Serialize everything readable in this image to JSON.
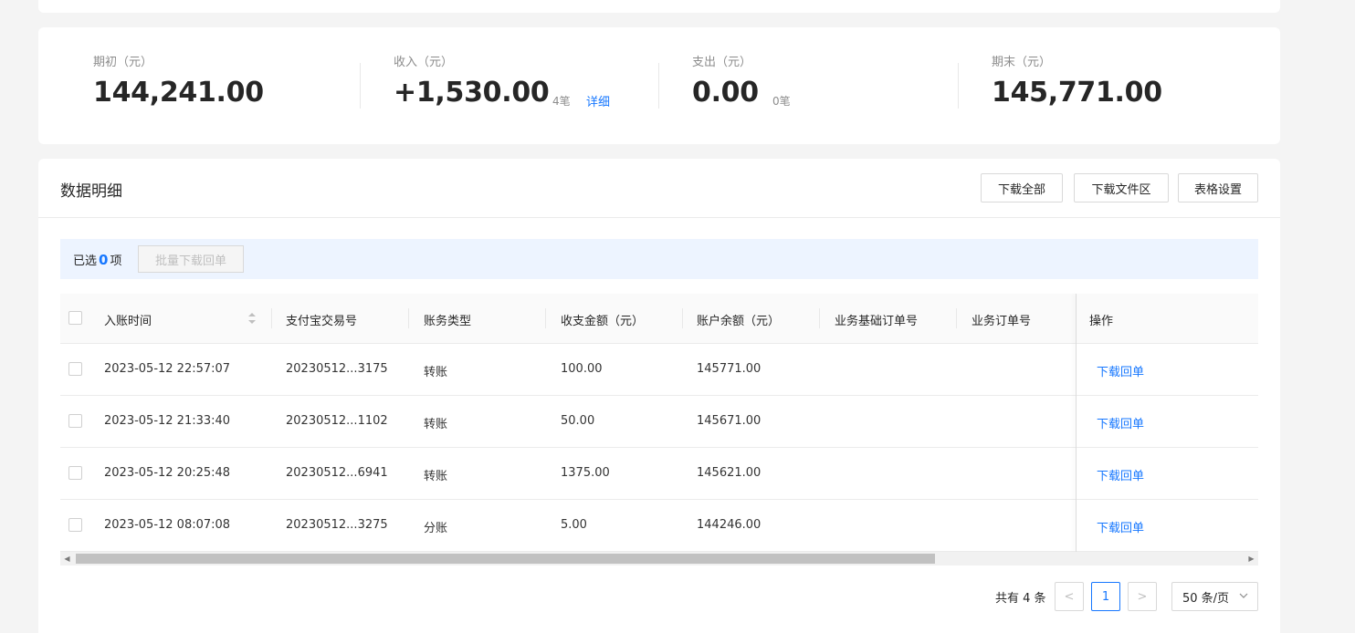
{
  "summary": [
    {
      "label": "期初（元）",
      "value": "144,241.00"
    },
    {
      "label": "收入（元）",
      "value": "+1,530.00",
      "count": "4笔",
      "link": "详细"
    },
    {
      "label": "支出（元）",
      "value": "0.00",
      "count": "0笔"
    },
    {
      "label": "期末（元）",
      "value": "145,771.00"
    }
  ],
  "detail": {
    "title": "数据明细",
    "buttons": {
      "download_all": "下载全部",
      "download_area": "下载文件区",
      "table_settings": "表格设置"
    }
  },
  "selection": {
    "prefix": "已选",
    "count": "0",
    "suffix": "项",
    "batch_button": "批量下载回单"
  },
  "table": {
    "columns": [
      "入账时间",
      "支付宝交易号",
      "账务类型",
      "收支金额（元）",
      "账户余额（元）",
      "业务基础订单号",
      "业务订单号",
      "操作"
    ],
    "rows": [
      {
        "time": "2023-05-12 22:57:07",
        "trade_no": "20230512...3175",
        "type": "转账",
        "amount": "100.00",
        "balance": "145771.00",
        "action": "下载回单"
      },
      {
        "time": "2023-05-12 21:33:40",
        "trade_no": "20230512...1102",
        "type": "转账",
        "amount": "50.00",
        "balance": "145671.00",
        "action": "下载回单"
      },
      {
        "time": "2023-05-12 20:25:48",
        "trade_no": "20230512...6941",
        "type": "转账",
        "amount": "1375.00",
        "balance": "145621.00",
        "action": "下载回单"
      },
      {
        "time": "2023-05-12 08:07:08",
        "trade_no": "20230512...3275",
        "type": "分账",
        "amount": "5.00",
        "balance": "144246.00",
        "action": "下载回单"
      }
    ]
  },
  "pagination": {
    "total": "共有 4 条",
    "current_page": "1",
    "page_size": "50 条/页",
    "prev": "<",
    "next": ">"
  },
  "icons": {
    "prev": "chevron-left-icon",
    "next": "chevron-right-icon",
    "sort": "sort-icon",
    "dropdown": "chevron-down-icon"
  },
  "colors": {
    "accent": "#1677ff",
    "selection_bg": "#edf4ff"
  }
}
